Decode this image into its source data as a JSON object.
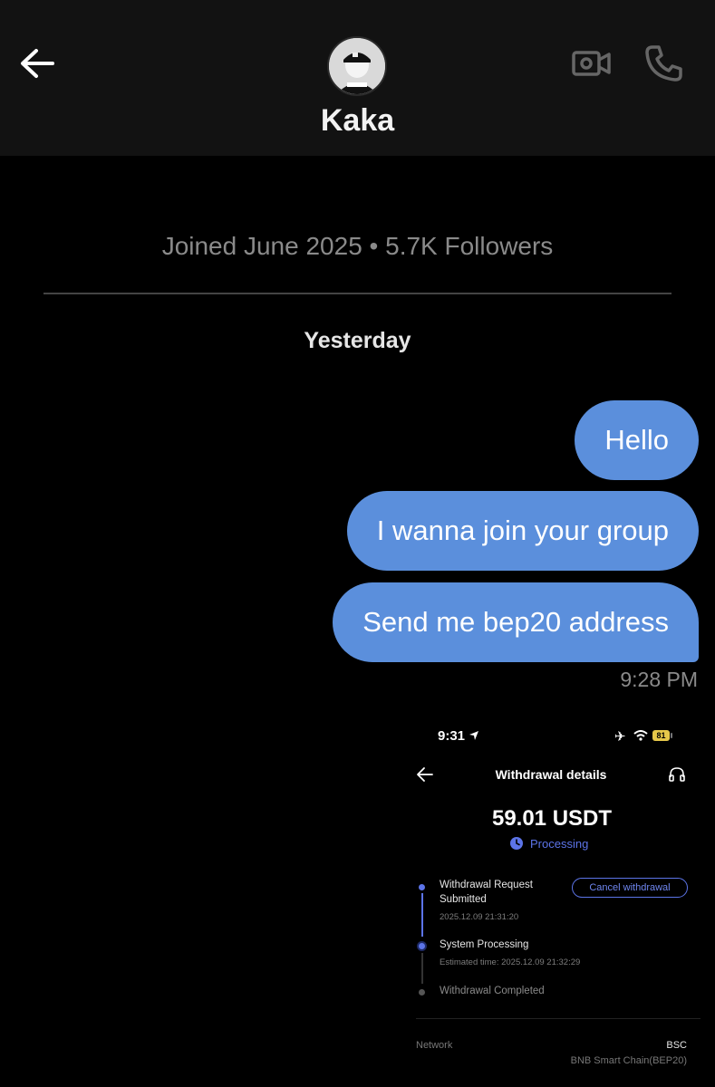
{
  "header": {
    "back_icon": "arrow-left-icon",
    "contact_name": "Kaka",
    "avatar_icon": "profile-avatar",
    "video_icon": "video-camera-icon",
    "call_icon": "phone-icon"
  },
  "profile_meta": "Joined June 2025 • 5.7K Followers",
  "date_separator": "Yesterday",
  "messages": [
    {
      "text": "Hello",
      "direction": "outgoing"
    },
    {
      "text": "I wanna join your group",
      "direction": "outgoing"
    },
    {
      "text": "Send me bep20 address",
      "direction": "outgoing"
    }
  ],
  "message_time": "9:28 PM",
  "attachment": {
    "status_bar": {
      "time": "9:31",
      "battery": "81"
    },
    "title": "Withdrawal details",
    "amount": "59.01 USDT",
    "status": "Processing",
    "cancel_label": "Cancel withdrawal",
    "steps": [
      {
        "title": "Withdrawal Request Submitted",
        "detail": "2025.12.09 21:31:20"
      },
      {
        "title": "System Processing",
        "detail": "Estimated time: 2025.12.09 21:32:29"
      },
      {
        "title": "Withdrawal Completed",
        "detail": ""
      }
    ],
    "network_label": "Network",
    "network_value": "BSC",
    "network_sub": "BNB Smart Chain(BEP20)"
  },
  "colors": {
    "bubble": "#5b8fdc",
    "accent": "#5c74e8",
    "battery": "#e6c84a"
  }
}
